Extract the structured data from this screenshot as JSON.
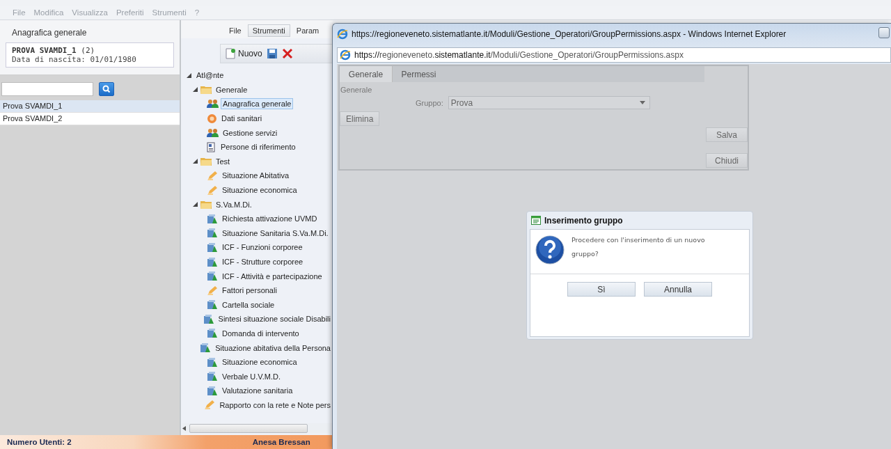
{
  "menu_bar": [
    "File",
    "Modifica",
    "Visualizza",
    "Preferiti",
    "Strumenti",
    "?"
  ],
  "left_panel": {
    "title": "Anagrafica generale",
    "patient": {
      "name": "PROVA SVAMDI_1",
      "count": "(2)",
      "birth_label": "Data di nascita:",
      "birth_date": "01/01/1980"
    },
    "items": [
      {
        "label": "Prova SVAMDI_1",
        "selected": true
      },
      {
        "label": "Prova SVAMDI_2",
        "selected": false
      }
    ]
  },
  "middle_panel": {
    "menu": [
      {
        "label": "File",
        "selected": false
      },
      {
        "label": "Strumenti",
        "selected": true
      },
      {
        "label": "Param",
        "selected": false
      }
    ],
    "toolbar": {
      "new_label": "Nuovo"
    },
    "tree": [
      {
        "label": "Atl@nte",
        "expanded": true,
        "selected": false,
        "children": [
          {
            "label": "Generale",
            "kind": "folder",
            "expanded": true,
            "selected": false,
            "children": [
              {
                "label": "Anagrafica generale",
                "kind": "people",
                "selected": true
              },
              {
                "label": "Dati sanitari",
                "kind": "medical",
                "selected": false
              },
              {
                "label": "Gestione servizi",
                "kind": "people",
                "selected": false
              },
              {
                "label": "Persone di riferimento",
                "kind": "doc",
                "selected": false
              }
            ]
          },
          {
            "label": "Test",
            "kind": "folder",
            "expanded": true,
            "selected": false,
            "children": [
              {
                "label": "Situazione Abitativa",
                "kind": "edit",
                "selected": false
              },
              {
                "label": "Situazione economica",
                "kind": "edit",
                "selected": false
              }
            ]
          },
          {
            "label": "S.Va.M.Di.",
            "kind": "folder",
            "expanded": true,
            "selected": false,
            "children": [
              {
                "label": "Richiesta attivazione UVMD",
                "kind": "chart",
                "selected": false
              },
              {
                "label": "Situazione Sanitaria S.Va.M.Di.",
                "kind": "chart",
                "selected": false
              },
              {
                "label": "ICF - Funzioni corporee",
                "kind": "chart",
                "selected": false
              },
              {
                "label": "ICF - Strutture corporee",
                "kind": "chart",
                "selected": false
              },
              {
                "label": "ICF - Attività e partecipazione",
                "kind": "chart",
                "selected": false
              },
              {
                "label": "Fattori personali",
                "kind": "edit",
                "selected": false
              },
              {
                "label": "Cartella sociale",
                "kind": "chart",
                "selected": false
              },
              {
                "label": "Sintesi situazione sociale Disabili",
                "kind": "chart",
                "selected": false
              },
              {
                "label": "Domanda di intervento",
                "kind": "chart",
                "selected": false
              },
              {
                "label": "Situazione abitativa della Persona",
                "kind": "chart",
                "selected": false
              },
              {
                "label": "Situazione economica",
                "kind": "chart",
                "selected": false
              },
              {
                "label": "Verbale U.V.M.D.",
                "kind": "chart",
                "selected": false
              },
              {
                "label": "Valutazione sanitaria",
                "kind": "chart",
                "selected": false
              },
              {
                "label": "Rapporto con la rete e Note pers",
                "kind": "edit",
                "selected": false
              }
            ]
          }
        ]
      }
    ]
  },
  "status_bar": {
    "users": "Numero Utenti: 2",
    "operator": "Anesa Bressan"
  },
  "popup": {
    "title": "https://regioneveneto.sistematlante.it/Moduli/Gestione_Operatori/GroupPermissions.aspx - Windows Internet Explorer",
    "address": {
      "scheme": "https://",
      "host_pre": "regioneveneto.",
      "host_main": "sistematlante.it",
      "path": "/Moduli/Gestione_Operatori/GroupPermissions.aspx"
    },
    "tabs": [
      {
        "label": "Generale",
        "selected": true
      },
      {
        "label": "Permessi",
        "selected": false
      }
    ],
    "section": "Generale",
    "group_label": "Gruppo:",
    "group_value": "Prova",
    "buttons": {
      "delete": "Elimina",
      "save": "Salva",
      "close": "Chiudi"
    },
    "dialog": {
      "title": "Inserimento gruppo",
      "message": "Procedere con l'inserimento di un nuovo gruppo?",
      "buttons": [
        "Sì",
        "Annulla"
      ]
    }
  }
}
